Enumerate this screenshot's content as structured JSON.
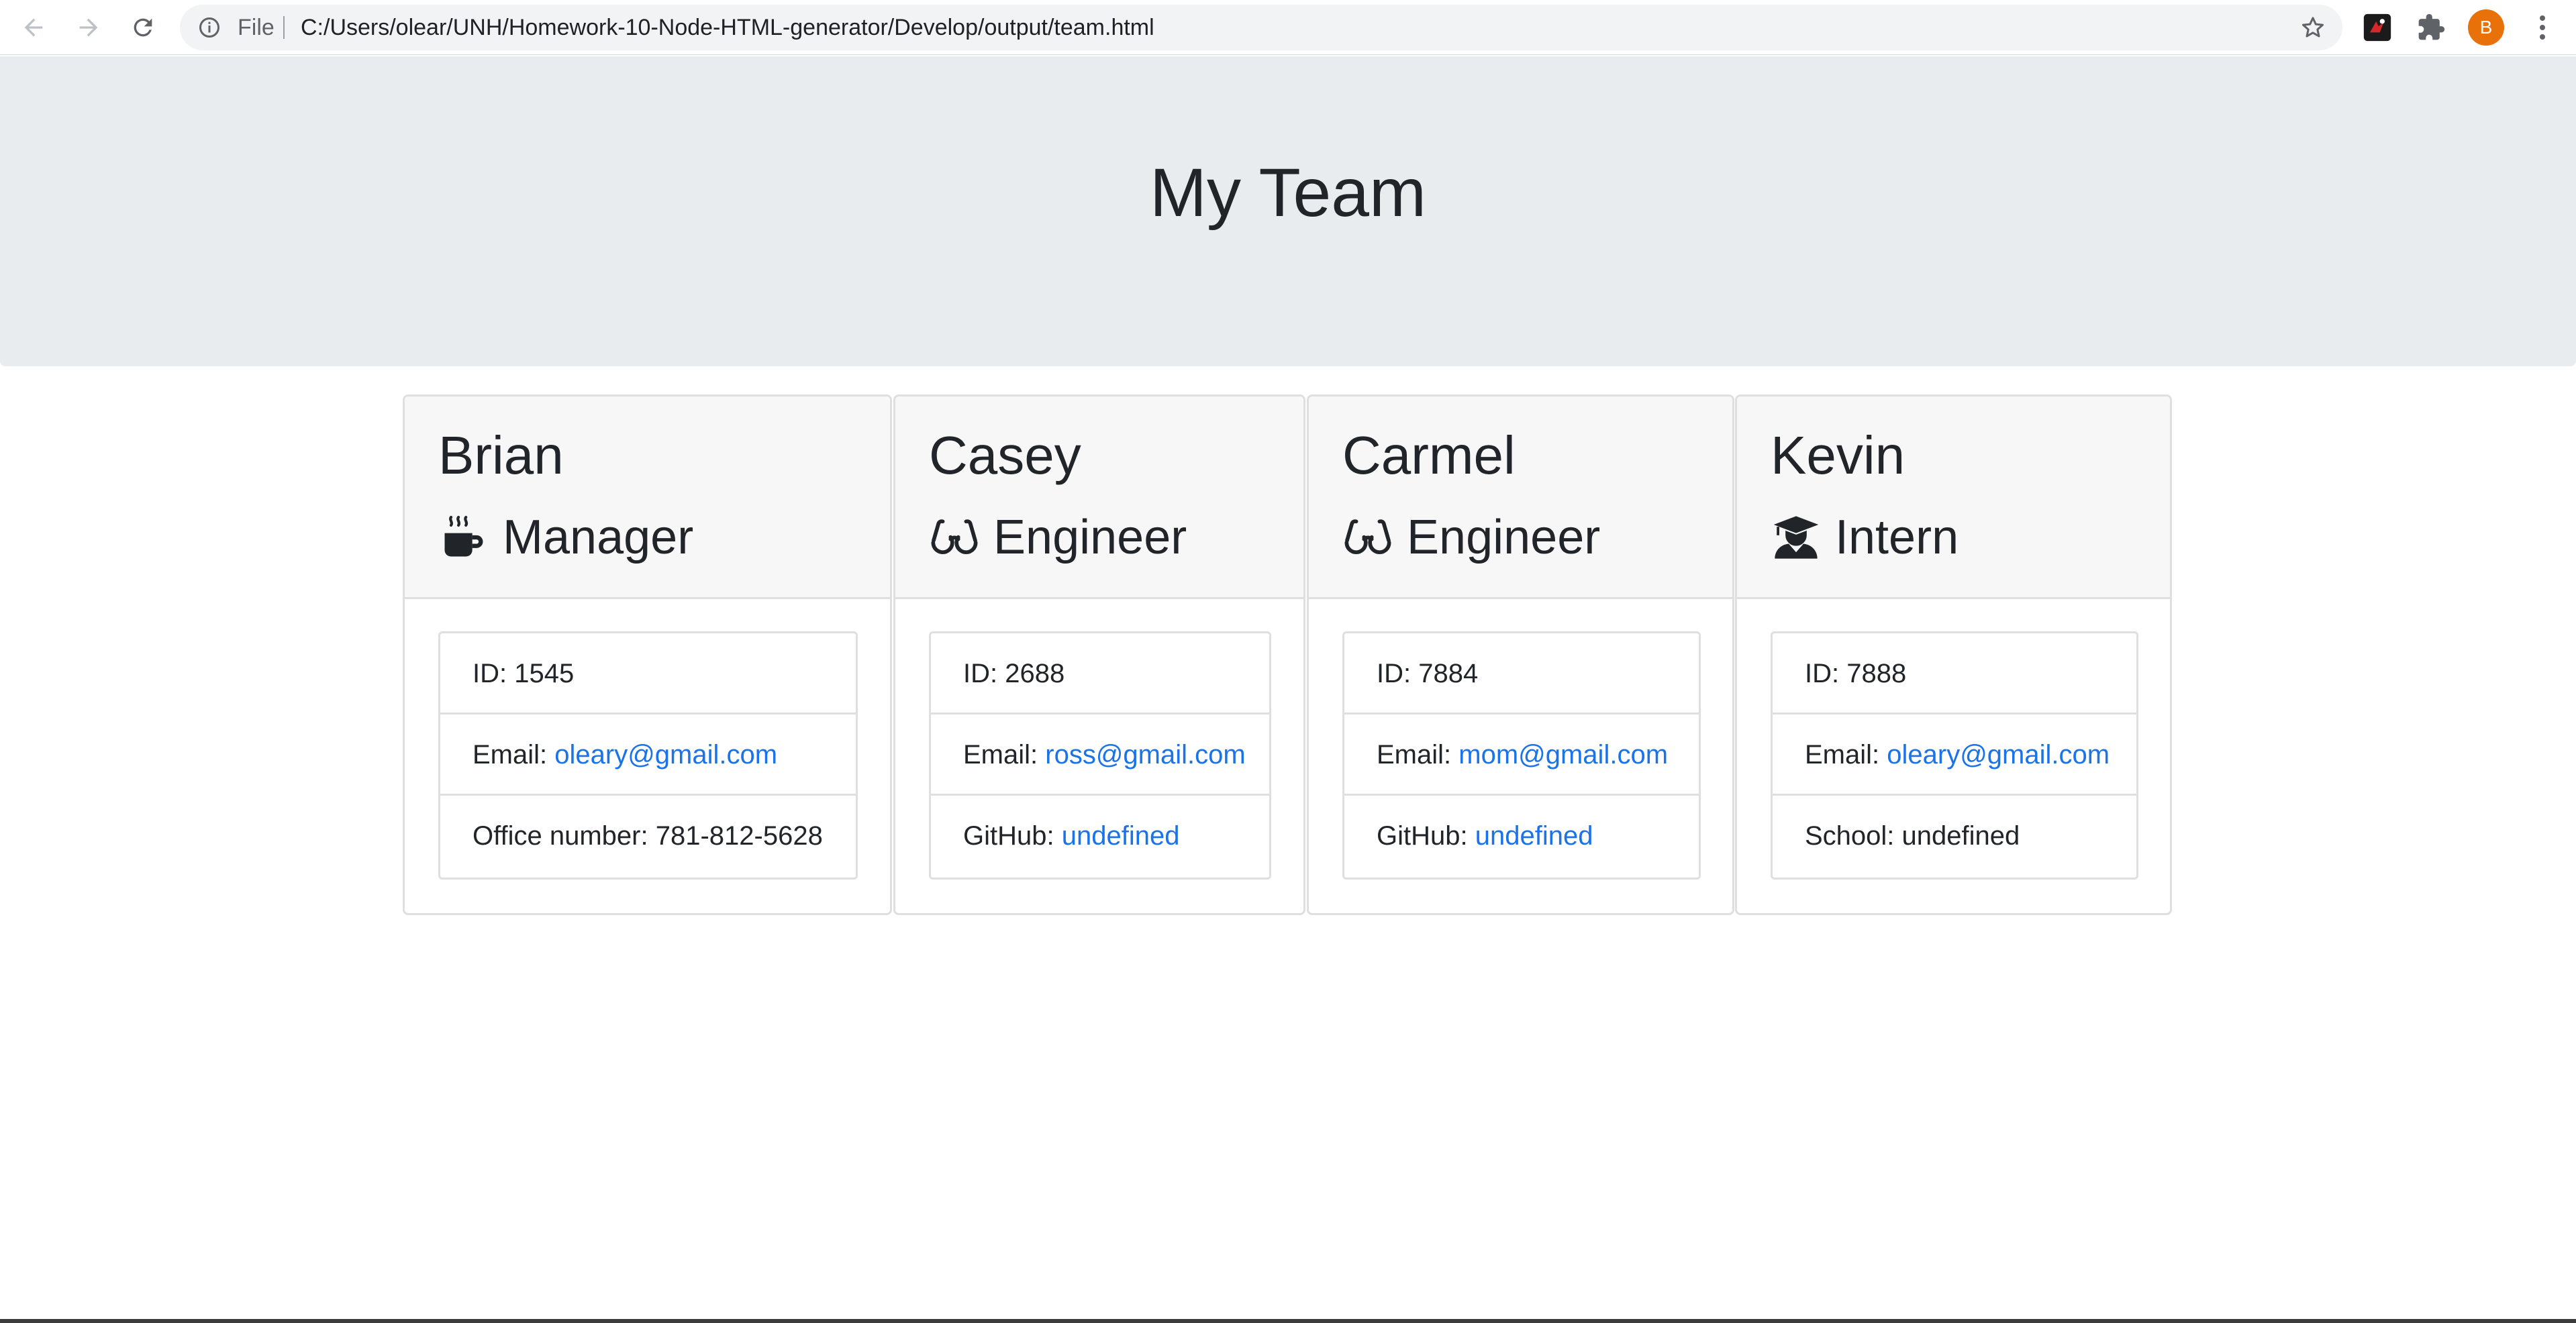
{
  "browser": {
    "scheme_label": "File",
    "url": "C:/Users/olear/UNH/Homework-10-Node-HTML-generator/Develop/output/team.html",
    "profile_initial": "B",
    "profile_color": "#e8710a"
  },
  "page": {
    "title": "My Team"
  },
  "employees": [
    {
      "name": "Brian",
      "role": "Manager",
      "icon": "mug-icon",
      "id_label": "ID: 1545",
      "email_prefix": "Email: ",
      "email": "oleary@gmail.com",
      "extra_prefix": "Office number: ",
      "extra": "781-812-5628",
      "extra_is_link": false
    },
    {
      "name": "Casey",
      "role": "Engineer",
      "icon": "glasses-icon",
      "id_label": "ID: 2688",
      "email_prefix": "Email: ",
      "email": "ross@gmail.com",
      "extra_prefix": "GitHub: ",
      "extra": "undefined",
      "extra_is_link": true
    },
    {
      "name": "Carmel",
      "role": "Engineer",
      "icon": "glasses-icon",
      "id_label": "ID: 7884",
      "email_prefix": "Email: ",
      "email": "mom@gmail.com",
      "extra_prefix": "GitHub: ",
      "extra": "undefined",
      "extra_is_link": true
    },
    {
      "name": "Kevin",
      "role": "Intern",
      "icon": "graduate-icon",
      "id_label": "ID: 7888",
      "email_prefix": "Email: ",
      "email": "oleary@gmail.com",
      "extra_prefix": "School: ",
      "extra": "undefined",
      "extra_is_link": false
    }
  ],
  "colors": {
    "jumbotron": "#e9ecef",
    "card_header": "#f7f7f7",
    "link": "#1a73e8"
  }
}
